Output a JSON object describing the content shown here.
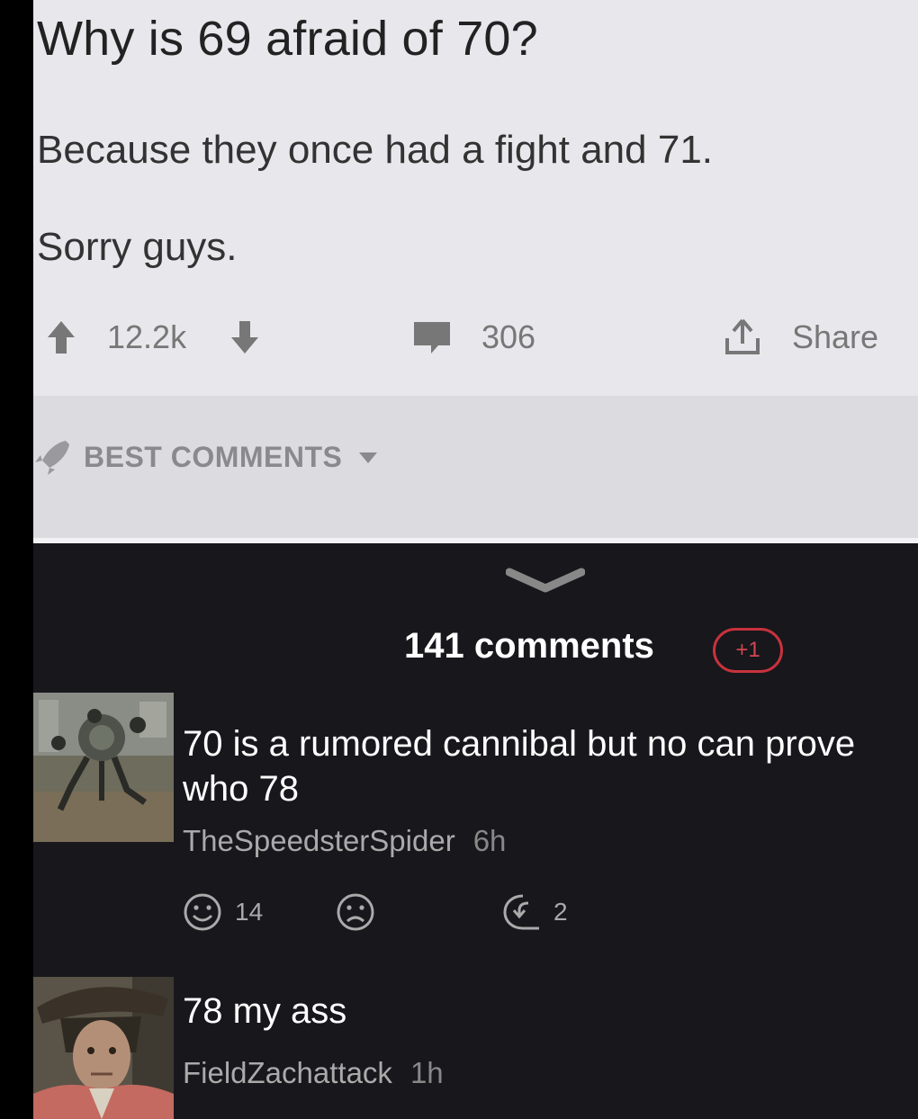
{
  "post": {
    "title": "Why is 69 afraid of 70?",
    "body_lines": [
      "Because they once had a fight and 71.",
      "Sorry guys."
    ],
    "votes": "12.2k",
    "comments": "306",
    "share_label": "Share"
  },
  "sort": {
    "label": "BEST COMMENTS"
  },
  "comments_header": {
    "count_label": "141 comments",
    "badge": "+1"
  },
  "comments": [
    {
      "text": "70 is a rumored cannibal but no can prove who 78",
      "author": "TheSpeedsterSpider",
      "time": "6h",
      "likes": "14",
      "replies": "2"
    },
    {
      "text": "78 my ass",
      "author": "FieldZachattack",
      "time": "1h"
    }
  ],
  "colors": {
    "badge": "#c8323c",
    "dark_bg": "#17171c",
    "light_bg": "#e8e8ec"
  },
  "icons": [
    "upvote-icon",
    "downvote-icon",
    "comment-icon",
    "share-icon",
    "rocket-icon",
    "caret-down-icon",
    "chevron-down-icon",
    "smile-icon",
    "frown-icon",
    "reply-icon"
  ]
}
